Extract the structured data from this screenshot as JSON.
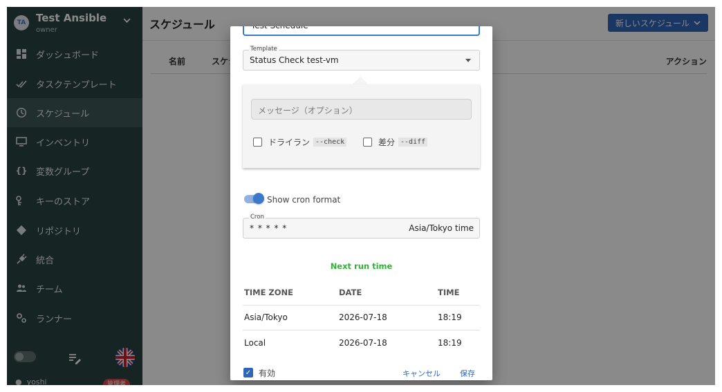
{
  "colors": {
    "sidebar_bg": "#2c4443",
    "accent": "#2f67b6",
    "next_run": "#2fb335"
  },
  "project": {
    "avatar": "TA",
    "title": "Test Ansible",
    "role": "owner"
  },
  "nav": [
    {
      "label": "ダッシュボード",
      "icon": "dashboard-icon"
    },
    {
      "label": "タスクテンプレート",
      "icon": "double-check-icon"
    },
    {
      "label": "スケジュール",
      "icon": "clock-icon",
      "active": true
    },
    {
      "label": "インベントリ",
      "icon": "monitor-icon"
    },
    {
      "label": "変数グループ",
      "icon": "braces-icon"
    },
    {
      "label": "キーのストア",
      "icon": "key-icon"
    },
    {
      "label": "リポジトリ",
      "icon": "git-icon"
    },
    {
      "label": "統合",
      "icon": "plug-icon"
    },
    {
      "label": "チーム",
      "icon": "people-icon"
    },
    {
      "label": "ランナー",
      "icon": "cogs-icon"
    }
  ],
  "user": {
    "name": "yoshi",
    "badge": "管理者"
  },
  "page": {
    "title": "スケジュール",
    "new_button": "新しいスケジュール"
  },
  "table": {
    "col_name": "名前",
    "col_schedule": "スケジュール",
    "col_actions": "アクション"
  },
  "dialog": {
    "name_value": "Test Schedule",
    "template_label": "Template",
    "template_value": "Status Check test-vm",
    "message_placeholder": "メッセージ（オプション）",
    "dry_run_label": "ドライラン",
    "dry_run_code": "--check",
    "diff_label": "差分",
    "diff_code": "--diff",
    "show_cron_label": "Show cron format",
    "show_cron_on": true,
    "cron_label": "Cron",
    "cron_value": "* * * * *",
    "cron_timezone": "Asia/Tokyo time",
    "next_run_title": "Next run time",
    "columns": [
      "TIME ZONE",
      "DATE",
      "TIME"
    ],
    "rows": [
      {
        "tz": "Asia/Tokyo",
        "date": "2026-07-18",
        "time": "18:19"
      },
      {
        "tz": "Local",
        "date": "2026-07-18",
        "time": "18:19"
      }
    ],
    "enabled_label": "有効",
    "enabled": true,
    "cancel": "キャンセル",
    "save": "保存"
  }
}
